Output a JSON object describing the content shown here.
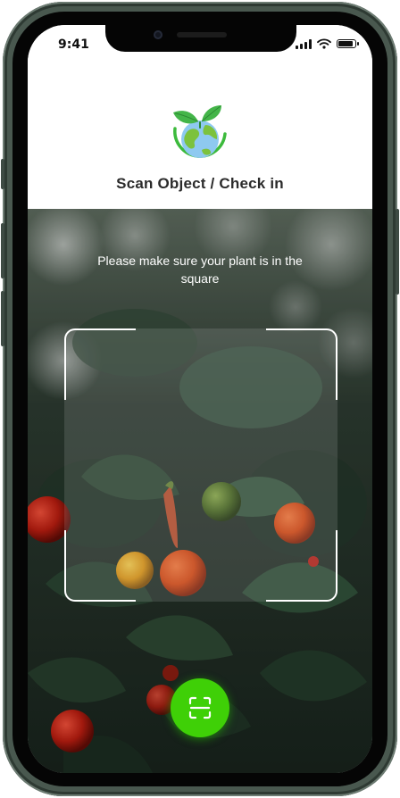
{
  "status_bar": {
    "time": "9:41"
  },
  "header": {
    "title": "Scan Object / Check in",
    "logo_icon": "earth-with-leaves-icon"
  },
  "camera": {
    "instruction": "Please make sure your plant is in the square",
    "scan_button_icon": "scan-icon"
  },
  "colors": {
    "accent": "#3fd007",
    "title_text": "#2b2b2b",
    "frame": "#ffffff"
  }
}
